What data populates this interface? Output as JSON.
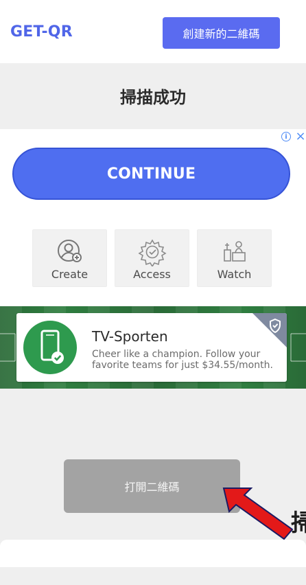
{
  "header": {
    "brand": "GET-QR",
    "create_label": "創建新的二維碼"
  },
  "main": {
    "title": "掃描成功"
  },
  "ad": {
    "info_icon": "info-icon",
    "close_icon": "close-icon",
    "continue_label": "CONTINUE",
    "tiles": [
      {
        "label": "Create",
        "icon": "person-add-icon"
      },
      {
        "label": "Access",
        "icon": "gear-check-icon"
      },
      {
        "label": "Watch",
        "icon": "people-icon"
      }
    ],
    "banner": {
      "title": "TV-Sporten",
      "description": "Cheer like a champion. Follow your favorite teams for just $34.55/month.",
      "icon": "phone-check-icon"
    }
  },
  "actions": {
    "open_qr_label": "打開二維碼"
  },
  "overlay": {
    "cut_text": "掃"
  },
  "colors": {
    "brand": "#5066e8",
    "accent": "#5a6bf0",
    "continue": "#4f6ef0",
    "open_button": "#a3a3a3",
    "banner_green": "#2f7e40",
    "arrow_red": "#e31919"
  }
}
